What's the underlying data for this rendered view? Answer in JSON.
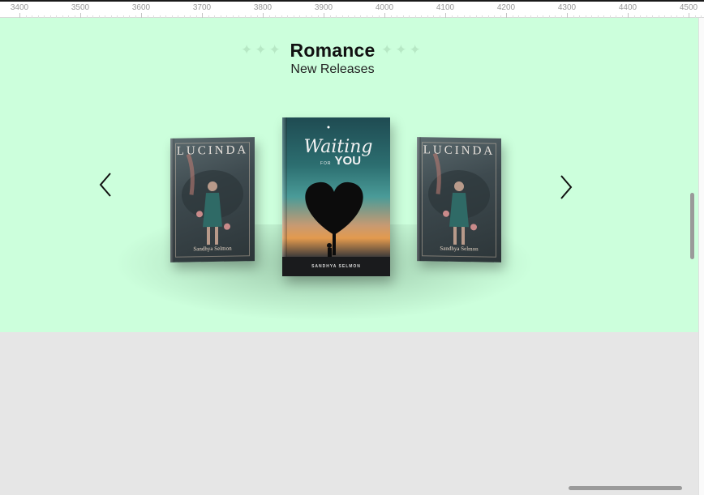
{
  "ruler": {
    "labels": [
      "3400",
      "3500",
      "3600",
      "3700",
      "3800",
      "3900",
      "4000",
      "4100",
      "4200",
      "4300",
      "4400",
      "4500"
    ]
  },
  "section": {
    "title": "Romance",
    "subtitle": "New Releases",
    "background": "#ccffdc",
    "decoration": "sparkles"
  },
  "carousel": {
    "prev_icon": "chevron-left-icon",
    "next_icon": "chevron-right-icon",
    "books": [
      {
        "title": "LUCINDA",
        "author": "Sandhya Selmon"
      },
      {
        "title": "Waiting",
        "title_small": "FOR",
        "title_large": "YOU",
        "author": "SANDHYA SELMON"
      },
      {
        "title": "LUCINDA",
        "author": "Sandhya Selmon"
      }
    ]
  }
}
